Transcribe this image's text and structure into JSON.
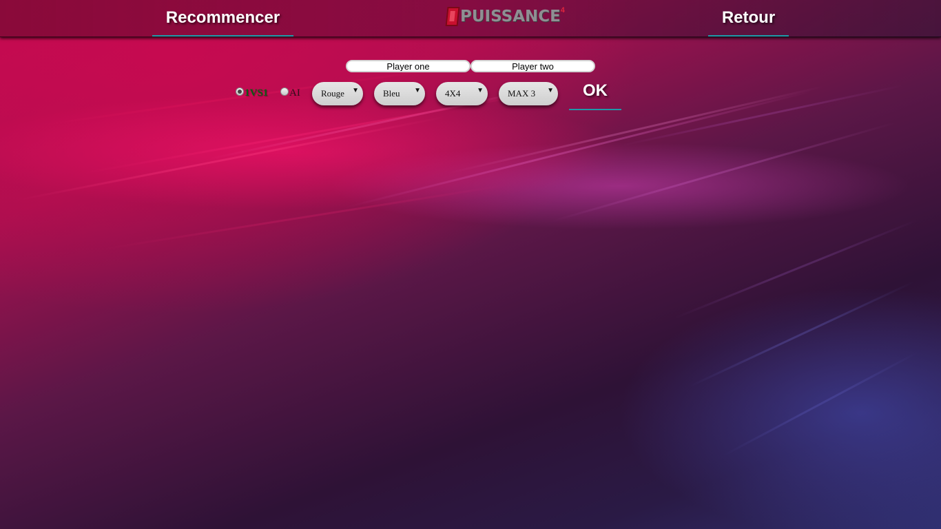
{
  "header": {
    "restart_label": "Recommencer",
    "back_label": "Retour",
    "logo": {
      "text": "PUISSANCE",
      "superscript": "4"
    }
  },
  "setup": {
    "player_one": {
      "value": "Player one"
    },
    "player_two": {
      "value": "Player two"
    },
    "mode_options": [
      {
        "label": "1VS1",
        "checked": true
      },
      {
        "label": "AI",
        "checked": false
      }
    ],
    "player_one_color": "Rouge",
    "player_two_color": "Bleu",
    "grid_size": "4X4",
    "max_setting": "MAX 3",
    "ok_label": "OK"
  },
  "colors": {
    "link_underline": "#1e9aa8",
    "one_vs_one_label": "#0d5c14",
    "logo_red": "#c8102e"
  }
}
